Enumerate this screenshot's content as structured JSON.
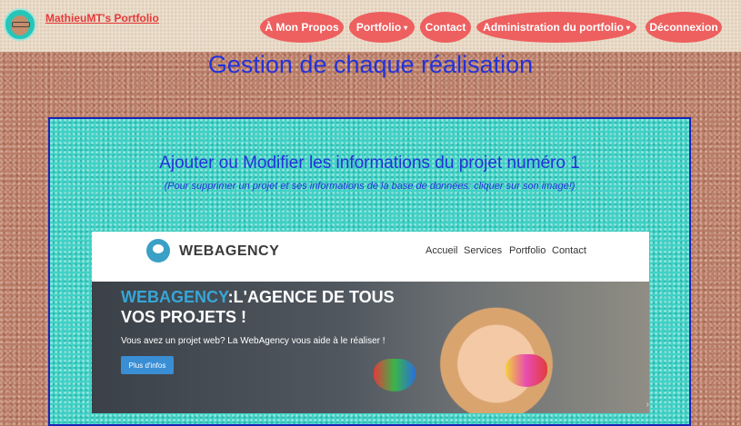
{
  "header": {
    "brand": "MathieuMT's Portfolio",
    "nav": [
      {
        "label": "À Mon Propos",
        "dropdown": false
      },
      {
        "label": "Portfolio",
        "dropdown": true
      },
      {
        "label": "Contact",
        "dropdown": false
      },
      {
        "label": "Administration du portfolio",
        "dropdown": true
      },
      {
        "label": "Déconnexion",
        "dropdown": false
      }
    ]
  },
  "page_title": "Gestion de chaque réalisation",
  "panel": {
    "heading": "Ajouter ou Modifier les informations du projet numéro 1",
    "note": "(Pour supprimer un projet et ses informations de la base de données: cliquer sur son image!)"
  },
  "preview": {
    "brand": "WEBAGENCY",
    "nav": [
      "Accueil",
      "Services",
      "Portfolio",
      "Contact"
    ],
    "headline_accent": "WEBAGENCY",
    "headline_rest": ":L'AGENCE DE TOUS",
    "headline_line2": "VOS PROJETS !",
    "subtext": "Vous avez un projet web? La WebAgency vous aide à le réaliser !",
    "button": "Plus d'infos"
  },
  "colors": {
    "nav_pill": "#ee5f5f",
    "title_blue": "#2332d8",
    "panel_teal": "#3fd2c6",
    "brand_red": "#e53a3a",
    "webagency_blue": "#36a6d8"
  }
}
